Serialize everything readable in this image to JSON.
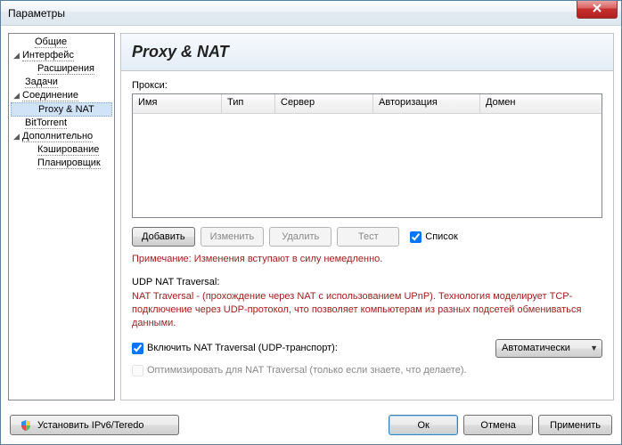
{
  "window": {
    "title": "Параметры"
  },
  "sidebar": {
    "items": [
      {
        "label": "Общие",
        "expandable": false
      },
      {
        "label": "Интерфейс",
        "expandable": true,
        "expanded": true
      },
      {
        "label": "Расширения",
        "indent": 2
      },
      {
        "label": "Задачи",
        "indent": 1
      },
      {
        "label": "Соединение",
        "expandable": true,
        "expanded": true
      },
      {
        "label": "Proxy & NAT",
        "indent": 2,
        "selected": true
      },
      {
        "label": "BitTorrent",
        "indent": 1
      },
      {
        "label": "Дополнительно",
        "expandable": true,
        "expanded": true
      },
      {
        "label": "Кэширование",
        "indent": 2
      },
      {
        "label": "Планировщик",
        "indent": 2
      }
    ]
  },
  "content": {
    "title": "Proxy & NAT",
    "proxy_label": "Прокси:",
    "columns": {
      "name": "Имя",
      "type": "Тип",
      "server": "Сервер",
      "auth": "Авторизация",
      "domain": "Домен"
    },
    "buttons": {
      "add": "Добавить",
      "edit": "Изменить",
      "delete": "Удалить",
      "test": "Тест"
    },
    "list_checkbox": "Список",
    "note": "Примечание: Изменения вступают в силу немедленно.",
    "udp": {
      "label": "UDP NAT Traversal:",
      "desc": "NAT Traversal - (прохождение через NAT с использованием UPnP). Технология моделирует TCP-подключение через UDP-протокол, что позволяет компьютерам из разных подсетей обмениваться данными.",
      "enable_label": "Включить NAT Traversal (UDP-транспорт):",
      "select_value": "Автоматически",
      "optimize_label": "Оптимизировать для NAT Traversal (только если знаете, что делаете)."
    }
  },
  "footer": {
    "install": "Установить IPv6/Teredo",
    "ok": "Ок",
    "cancel": "Отмена",
    "apply": "Применить"
  }
}
